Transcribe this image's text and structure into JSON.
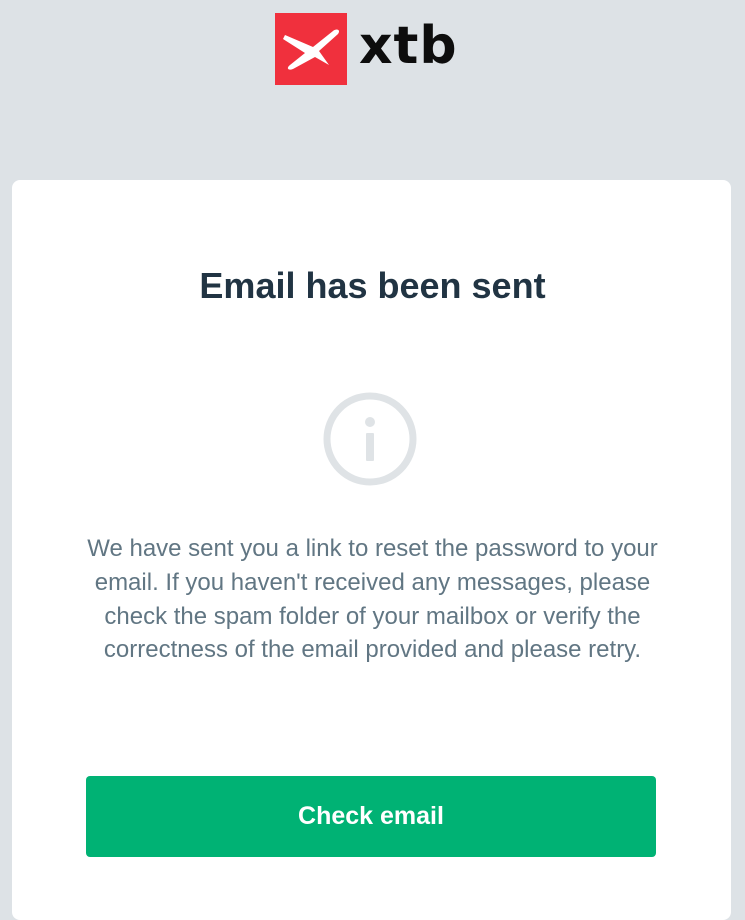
{
  "brand": {
    "logo_text": "xtb",
    "logo_icon": "xtb-x-mark-icon",
    "color": "#f0303d"
  },
  "dialog": {
    "title": "Email has been sent",
    "status_icon": "info-icon",
    "message": "We have sent you a link to reset the password to your email. If you haven't received any messages, please check the spam folder of your mailbox or verify the correctness of the email provided and please retry.",
    "button_label": "Check email"
  },
  "colors": {
    "background": "#dde2e6",
    "card": "#ffffff",
    "title": "#213443",
    "message": "#617683",
    "button": "#00b274",
    "icon": "#dfe3e6"
  }
}
